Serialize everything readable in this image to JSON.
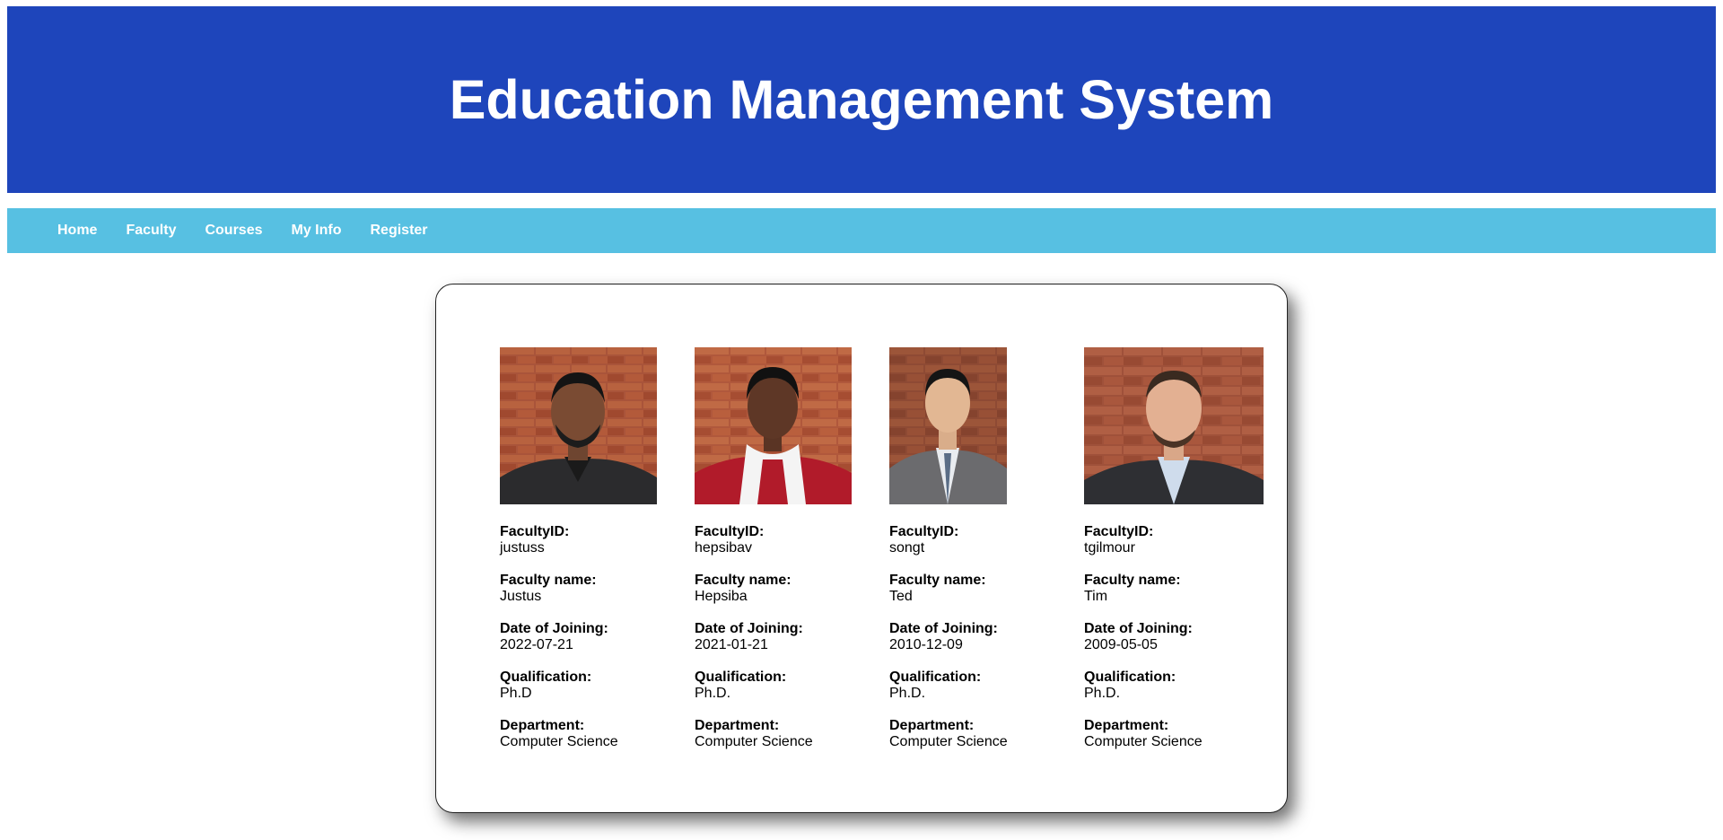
{
  "header": {
    "title": "Education Management System",
    "background_color": "#1e45bb"
  },
  "nav": {
    "background_color": "#57c0e2",
    "items": [
      {
        "label": "Home"
      },
      {
        "label": "Faculty"
      },
      {
        "label": "Courses"
      },
      {
        "label": "My Info"
      },
      {
        "label": "Register"
      }
    ]
  },
  "faculty_labels": {
    "id": "FacultyID:",
    "name": "Faculty name:",
    "joining": "Date of Joining:",
    "qualification": "Qualification:",
    "department": "Department:"
  },
  "faculty": [
    {
      "id": "justuss",
      "name": "Justus",
      "joining": "2022-07-21",
      "qualification": "Ph.D",
      "department": "Computer Science",
      "photo_icon": "faculty-photo-icon"
    },
    {
      "id": "hepsibav",
      "name": "Hepsiba",
      "joining": "2021-01-21",
      "qualification": "Ph.D.",
      "department": "Computer Science",
      "photo_icon": "faculty-photo-icon"
    },
    {
      "id": "songt",
      "name": "Ted",
      "joining": "2010-12-09",
      "qualification": "Ph.D.",
      "department": "Computer Science",
      "photo_icon": "faculty-photo-icon"
    },
    {
      "id": "tgilmour",
      "name": "Tim",
      "joining": "2009-05-05",
      "qualification": "Ph.D.",
      "department": "Computer Science",
      "photo_icon": "faculty-photo-icon"
    }
  ]
}
